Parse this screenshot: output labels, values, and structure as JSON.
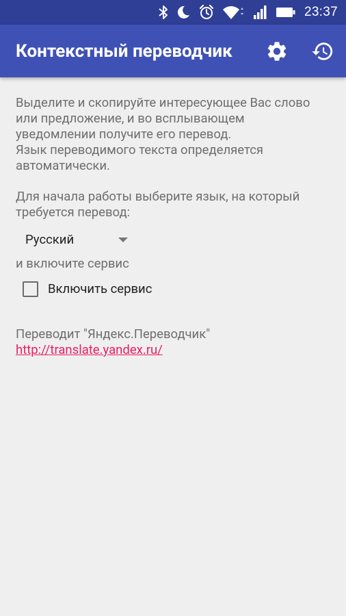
{
  "status_bar": {
    "time": "23:37",
    "icons": [
      "bluetooth-icon",
      "moon-icon",
      "alarm-icon",
      "wifi-icon",
      "signal-icon",
      "battery-icon"
    ]
  },
  "app_bar": {
    "title": "Контекстный переводчик",
    "actions": [
      "settings-icon",
      "history-icon"
    ],
    "color": "#3f51b5"
  },
  "content": {
    "intro_lines": [
      "Выделите и скопируйте интересующее Вас слово",
      "или предложение, и во всплывающем",
      "уведомлении получите его перевод.",
      "Язык переводимого текста определяется",
      "автоматически."
    ],
    "prompt_lines": [
      "Для начала работы выберите язык, на который",
      "требуется перевод:"
    ],
    "language_spinner": {
      "selected": "Русский"
    },
    "enable_hint": "и включите сервис",
    "service_checkbox": {
      "label": "Включить сервис",
      "checked": false
    },
    "credit": "Переводит \"Яндекс.Переводчик\"",
    "link": "http://translate.yandex.ru/",
    "link_color": "#e91e63"
  }
}
